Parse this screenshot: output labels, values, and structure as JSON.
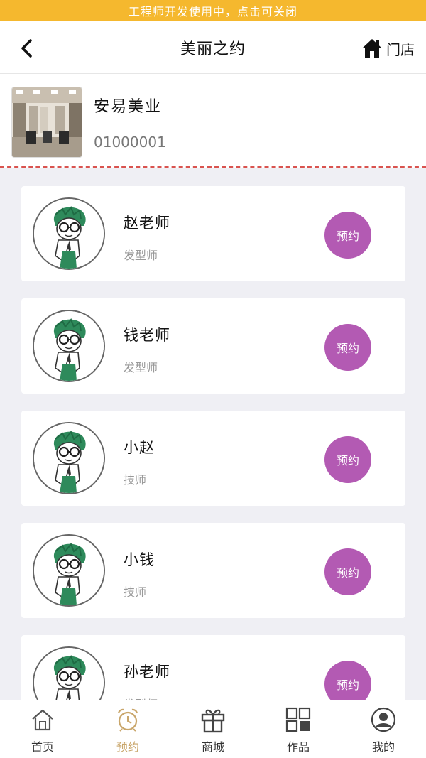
{
  "dev_banner": "工程师开发使用中，点击可关闭",
  "header": {
    "title": "美丽之约",
    "store_link": "门店"
  },
  "store": {
    "name": "安易美业",
    "id": "01000001"
  },
  "booking_label": "预约",
  "stylists": [
    {
      "name": "赵老师",
      "role": "发型师"
    },
    {
      "name": "钱老师",
      "role": "发型师"
    },
    {
      "name": "小赵",
      "role": "技师"
    },
    {
      "name": "小钱",
      "role": "技师"
    },
    {
      "name": "孙老师",
      "role": "发型师"
    }
  ],
  "tabs": [
    {
      "label": "首页",
      "icon": "home-icon"
    },
    {
      "label": "预约",
      "icon": "alarm-clock-icon"
    },
    {
      "label": "商城",
      "icon": "gift-icon"
    },
    {
      "label": "作品",
      "icon": "grid-icon"
    },
    {
      "label": "我的",
      "icon": "user-icon"
    }
  ],
  "colors": {
    "banner": "#f5b82e",
    "book_button": "#b35ab3",
    "active_tab": "#c9a66b",
    "divider": "#d9534f"
  }
}
